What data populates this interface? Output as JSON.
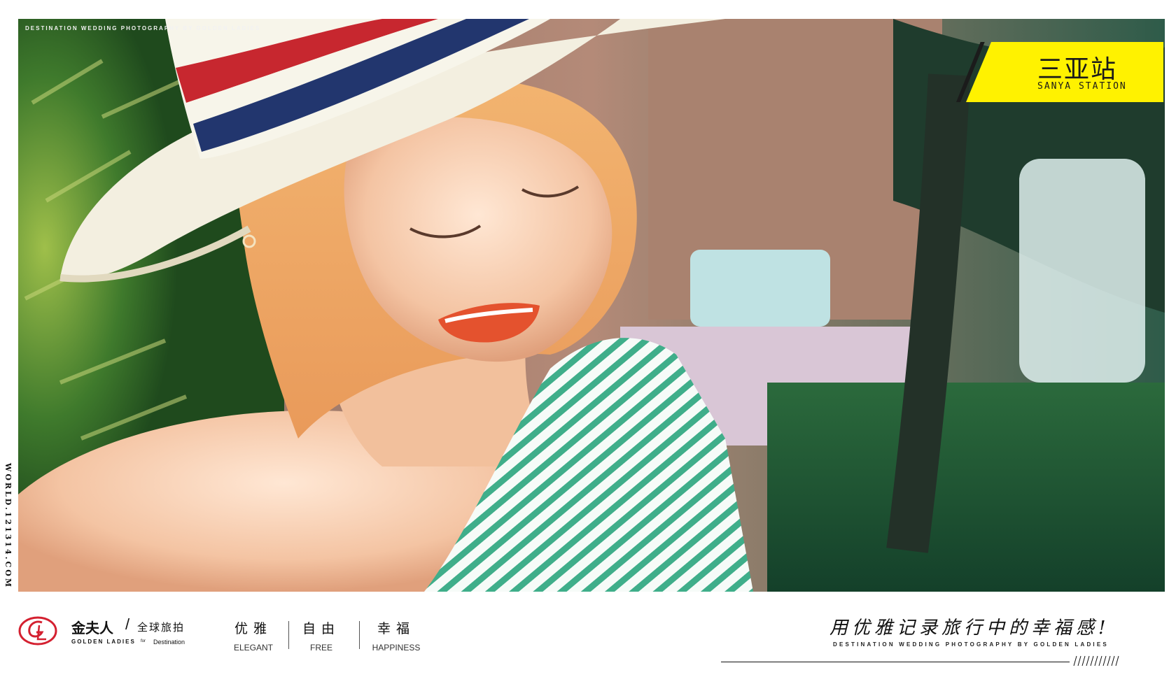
{
  "photo": {
    "caption_top": "DESTINATION WEDDING PHOTOGRAPHY BY GOLDEN LADIES",
    "description_icon": "portrait-photo"
  },
  "side_url": "WORLD.121314.COM",
  "station": {
    "zh": "三亚站",
    "en": "SANYA STATION",
    "accent": "#fff200"
  },
  "brand": {
    "logo_color": "#d42030",
    "zh": "金夫人",
    "separator": "/",
    "sub": "全球旅拍",
    "en": "GOLDEN LADIES",
    "for": "for",
    "destination": "Destination"
  },
  "values": [
    {
      "zh": "优雅",
      "en": "ELEGANT"
    },
    {
      "zh": "自由",
      "en": "FREE"
    },
    {
      "zh": "幸福",
      "en": "HAPPINESS"
    }
  ],
  "slogan": {
    "zh": "用优雅记录旅行中的幸福感!",
    "en": "DESTINATION WEDDING PHOTOGRAPHY BY GOLDEN LADIES"
  }
}
